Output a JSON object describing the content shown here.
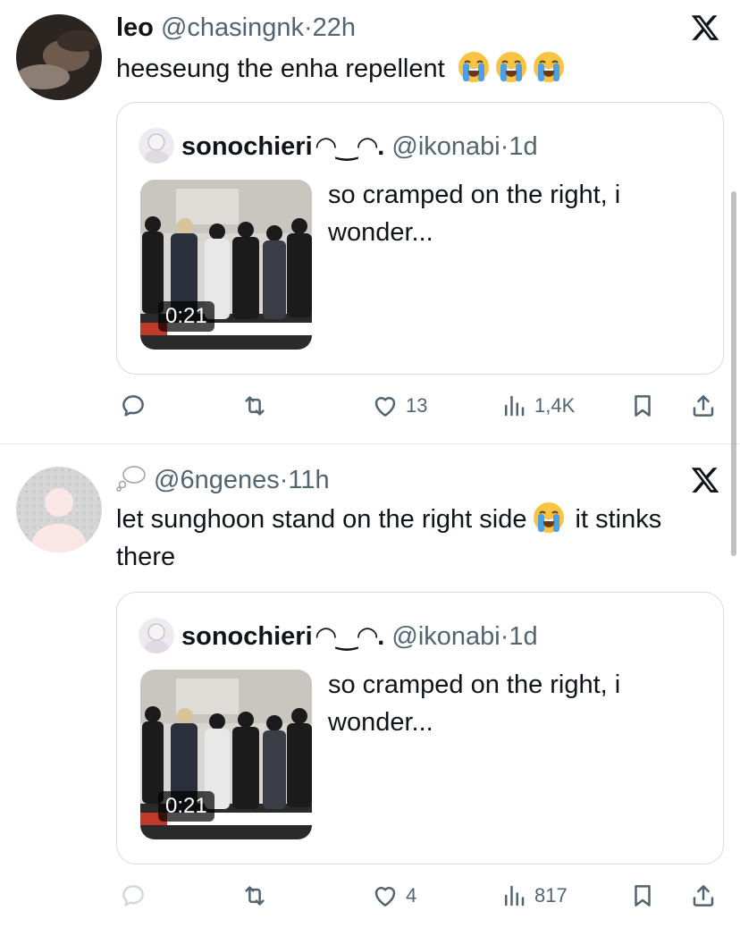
{
  "tweets": [
    {
      "name": "leo",
      "handle": "@chasingnk",
      "separator": "·",
      "time": "22h",
      "text": "heeseung the enha repellent",
      "emoji": "loudly-crying-face",
      "emoji_count": 3,
      "quote": {
        "name": "sonochieri",
        "kaomoji": "◠‿◠.",
        "handle": "@ikonabi",
        "separator": "·",
        "time": "1d",
        "text": "so cramped on the right, i wonder...",
        "video_duration": "0:21"
      },
      "stats": {
        "replies": "",
        "reposts": "",
        "likes": "13",
        "views": "1,4K"
      }
    },
    {
      "name": "",
      "handle": "@6ngenes",
      "separator": "·",
      "time": "11h",
      "text_before": "let sunghoon stand on the right side",
      "text_after": " it stinks there",
      "emoji": "loudly-crying-face",
      "quote": {
        "name": "sonochieri",
        "kaomoji": "◠‿◠.",
        "handle": "@ikonabi",
        "separator": "·",
        "time": "1d",
        "text": "so cramped on the right, i wonder...",
        "video_duration": "0:21"
      },
      "stats": {
        "replies": "",
        "reposts": "",
        "likes": "4",
        "views": "817"
      }
    }
  ],
  "colors": {
    "text": "#0f1419",
    "secondary": "#536471",
    "border": "#d6dbdf",
    "emoji_face": "#f8c342",
    "emoji_tear": "#4a9fe8"
  }
}
